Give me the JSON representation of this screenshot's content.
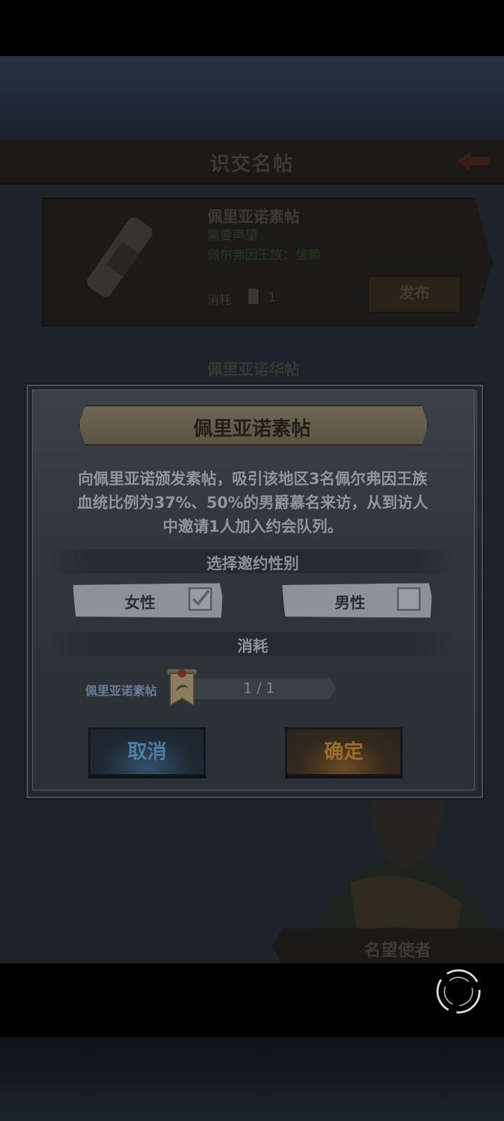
{
  "background": {
    "header_title": "识交名帖",
    "card": {
      "title": "佩里亚诺素帖",
      "requirement": "需要声望",
      "family": "佩尔弗因王族：信赖",
      "cost_label": "消耗",
      "cost_value": "1",
      "publish_button": "发布"
    },
    "card2_title": "佩里亚诺华帖",
    "ribbon_text": "名望使者"
  },
  "dialog": {
    "title": "佩里亚诺素帖",
    "description_lines": [
      "向佩里亚诺颁发素帖，吸引该地区3名佩尔弗因王族",
      "血统比例为37%、50%的男爵慕名来访，从到访人",
      "中邀请1人加入约会队列。"
    ],
    "gender_section_title": "选择邀约性别",
    "options": {
      "female": {
        "label": "女性",
        "checked": true
      },
      "male": {
        "label": "男性",
        "checked": false
      }
    },
    "cost_section_title": "消耗",
    "cost_item": {
      "label": "佩里亚诺素帖",
      "count": "1 / 1",
      "icon": "scroll-banner-icon"
    },
    "cancel_button": "取消",
    "confirm_button": "确定"
  },
  "colors": {
    "cancel_text": "#4f7ea5",
    "confirm_text": "#9b6d2d",
    "cost_item_label": "#6a7a93"
  }
}
